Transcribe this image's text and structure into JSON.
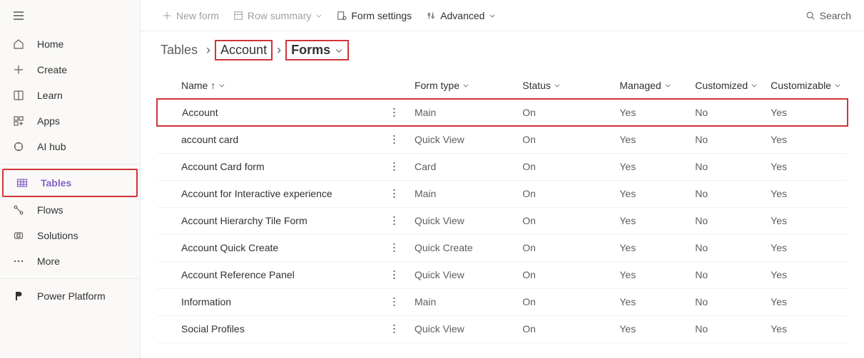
{
  "sidebar": {
    "items": [
      {
        "label": "Home"
      },
      {
        "label": "Create"
      },
      {
        "label": "Learn"
      },
      {
        "label": "Apps"
      },
      {
        "label": "AI hub"
      },
      {
        "label": "Tables"
      },
      {
        "label": "Flows"
      },
      {
        "label": "Solutions"
      },
      {
        "label": "More"
      },
      {
        "label": "Power Platform"
      }
    ]
  },
  "commandbar": {
    "new_form": "New form",
    "row_summary": "Row summary",
    "form_settings": "Form settings",
    "advanced": "Advanced"
  },
  "search": {
    "placeholder": "Search"
  },
  "breadcrumb": {
    "root": "Tables",
    "parent": "Account",
    "current": "Forms"
  },
  "columns": {
    "name": "Name",
    "form_type": "Form type",
    "status": "Status",
    "managed": "Managed",
    "customized": "Customized",
    "customizable": "Customizable"
  },
  "rows": [
    {
      "name": "Account",
      "form_type": "Main",
      "status": "On",
      "managed": "Yes",
      "customized": "No",
      "customizable": "Yes",
      "highlighted": true
    },
    {
      "name": "account card",
      "form_type": "Quick View",
      "status": "On",
      "managed": "Yes",
      "customized": "No",
      "customizable": "Yes"
    },
    {
      "name": "Account Card form",
      "form_type": "Card",
      "status": "On",
      "managed": "Yes",
      "customized": "No",
      "customizable": "Yes"
    },
    {
      "name": "Account for Interactive experience",
      "form_type": "Main",
      "status": "On",
      "managed": "Yes",
      "customized": "No",
      "customizable": "Yes"
    },
    {
      "name": "Account Hierarchy Tile Form",
      "form_type": "Quick View",
      "status": "On",
      "managed": "Yes",
      "customized": "No",
      "customizable": "Yes"
    },
    {
      "name": "Account Quick Create",
      "form_type": "Quick Create",
      "status": "On",
      "managed": "Yes",
      "customized": "No",
      "customizable": "Yes"
    },
    {
      "name": "Account Reference Panel",
      "form_type": "Quick View",
      "status": "On",
      "managed": "Yes",
      "customized": "No",
      "customizable": "Yes"
    },
    {
      "name": "Information",
      "form_type": "Main",
      "status": "On",
      "managed": "Yes",
      "customized": "No",
      "customizable": "Yes"
    },
    {
      "name": "Social Profiles",
      "form_type": "Quick View",
      "status": "On",
      "managed": "Yes",
      "customized": "No",
      "customizable": "Yes"
    }
  ]
}
